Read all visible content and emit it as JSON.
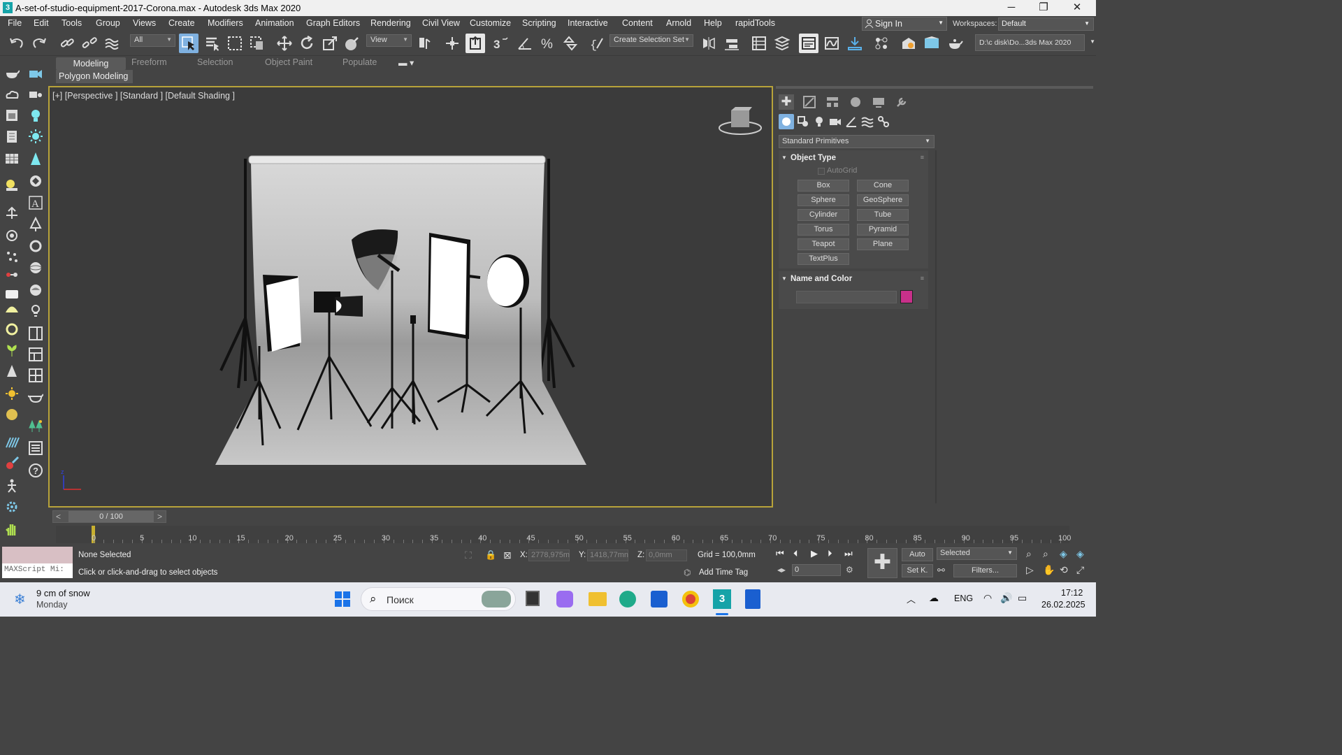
{
  "window": {
    "title": "A-set-of-studio-equipment-2017-Corona.max - Autodesk 3ds Max 2020",
    "app_icon": "3",
    "controls": [
      "─",
      "❐",
      "✕"
    ]
  },
  "menubar": {
    "items": [
      "File",
      "Edit",
      "Tools",
      "Group",
      "Views",
      "Create",
      "Modifiers",
      "Animation",
      "Graph Editors",
      "Rendering",
      "Civil View",
      "Customize",
      "Scripting",
      "Interactive",
      "Content",
      "Arnold",
      "Help",
      "rapidTools"
    ],
    "sign_in": "Sign In",
    "workspaces_label": "Workspaces:",
    "workspace_value": "Default"
  },
  "toolbar": {
    "filter_value": "All",
    "ref_coord_value": "View",
    "selection_set_label": "Create Selection Set",
    "path_value": "D:\\c disk\\Do...3ds Max 2020"
  },
  "ribbon": {
    "tabs": [
      "Modeling",
      "Freeform",
      "Selection",
      "Object Paint",
      "Populate"
    ],
    "panel_label": "Polygon Modeling"
  },
  "viewport": {
    "label": "[+] [Perspective ] [Standard ] [Default Shading ]"
  },
  "command_panel": {
    "category_value": "Standard Primitives",
    "object_type_title": "Object Type",
    "autogrid_label": "AutoGrid",
    "buttons": [
      "Box",
      "Cone",
      "Sphere",
      "GeoSphere",
      "Cylinder",
      "Tube",
      "Torus",
      "Pyramid",
      "Teapot",
      "Plane",
      "TextPlus"
    ],
    "name_color_title": "Name and Color",
    "name_value": "",
    "object_color": "#c8308a"
  },
  "timeline": {
    "frame_display": "0 / 100",
    "prev": "<",
    "next": ">",
    "ticks": [
      "0",
      "5",
      "10",
      "15",
      "20",
      "25",
      "30",
      "35",
      "40",
      "45",
      "50",
      "55",
      "60",
      "65",
      "70",
      "75",
      "80",
      "85",
      "90",
      "95",
      "100"
    ]
  },
  "status": {
    "maxscript_label": "MAXScript Mi:",
    "selection_status": "None Selected",
    "prompt": "Click or click-and-drag to select objects",
    "x_label": "X:",
    "x_value": "2778,975m",
    "y_label": "Y:",
    "y_value": "1418,77mn",
    "z_label": "Z:",
    "z_value": "0,0mm",
    "grid": "Grid = 100,0mm",
    "add_time_tag": "Add Time Tag",
    "auto_key": "Auto",
    "set_key": "Set K.",
    "key_filter_value": "Selected",
    "filters": "Filters...",
    "frame_value": "0"
  },
  "taskbar": {
    "weather_title": "9 cm of snow",
    "weather_sub": "Monday",
    "search_placeholder": "Поиск",
    "lang": "ENG",
    "time": "17:12",
    "date": "26.02.2025"
  }
}
